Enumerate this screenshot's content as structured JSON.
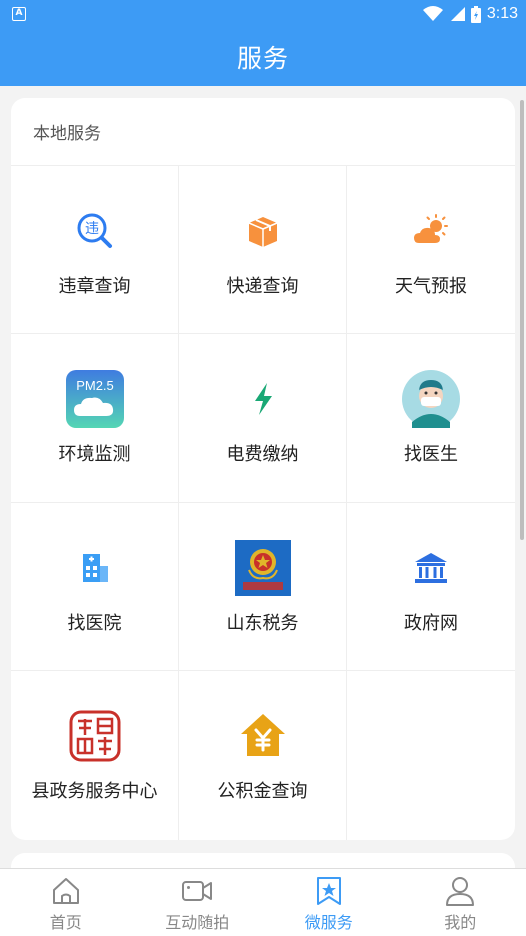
{
  "status_bar": {
    "app_icon": "A",
    "time": "3:13"
  },
  "header": {
    "title": "服务"
  },
  "section": {
    "title": "本地服务",
    "items": [
      {
        "label": "违章查询",
        "icon": "violation-search-icon"
      },
      {
        "label": "快递查询",
        "icon": "package-icon"
      },
      {
        "label": "天气预报",
        "icon": "weather-icon"
      },
      {
        "label": "环境监测",
        "icon": "pm25-icon",
        "icon_text": "PM2.5"
      },
      {
        "label": "电费缴纳",
        "icon": "lightning-icon"
      },
      {
        "label": "找医生",
        "icon": "doctor-icon"
      },
      {
        "label": "找医院",
        "icon": "hospital-icon"
      },
      {
        "label": "山东税务",
        "icon": "tax-emblem-icon"
      },
      {
        "label": "政府网",
        "icon": "government-building-icon"
      },
      {
        "label": "县政务服务中心",
        "icon": "seal-icon"
      },
      {
        "label": "公积金查询",
        "icon": "housing-fund-icon"
      }
    ]
  },
  "bottom_nav": {
    "items": [
      {
        "label": "首页",
        "icon": "home-icon"
      },
      {
        "label": "互动随拍",
        "icon": "video-camera-icon"
      },
      {
        "label": "微服务",
        "icon": "star-bookmark-icon",
        "active": true
      },
      {
        "label": "我的",
        "icon": "user-icon"
      }
    ]
  },
  "colors": {
    "primary": "#3d9bf5",
    "orange": "#f7913d",
    "green": "#1aa875",
    "gold": "#e8a316"
  }
}
